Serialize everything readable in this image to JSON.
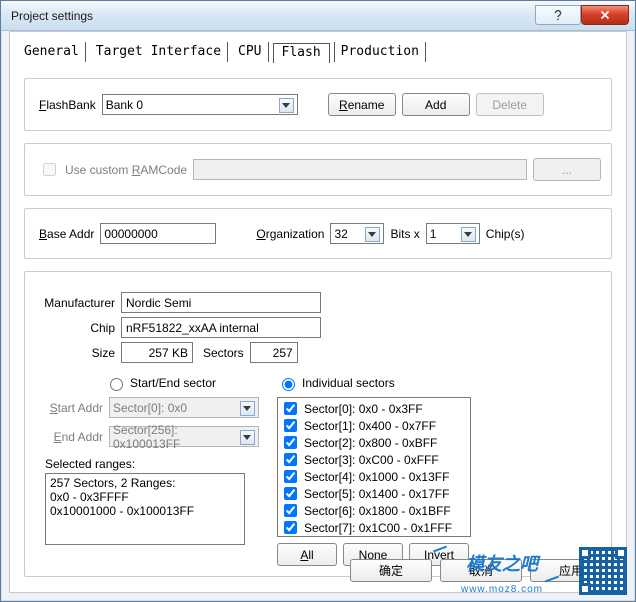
{
  "window": {
    "title": "Project settings"
  },
  "tabs": [
    {
      "label": "General"
    },
    {
      "label": "Target Interface"
    },
    {
      "label": "CPU"
    },
    {
      "label": "Flash"
    },
    {
      "label": "Production"
    }
  ],
  "bank": {
    "label_head": "F",
    "label_tail": "lashBank",
    "selected": "Bank 0",
    "rename_head": "R",
    "rename_tail": "ename",
    "add": "Add",
    "delete": "Delete"
  },
  "ramcode": {
    "label_pre": "Use custom ",
    "label_u": "R",
    "label_post": "AMCode",
    "value": ""
  },
  "addr": {
    "base_head": "B",
    "base_tail": "ase Addr",
    "base_value": "00000000",
    "org_head": "O",
    "org_tail": "rganization",
    "org_value": "32",
    "bits_label": "Bits x",
    "bits_value": "1",
    "chips_label": "Chip(s)"
  },
  "info": {
    "manu_label": "Manufacturer",
    "manu_value": "Nordic Semi",
    "chip_label": "Chip",
    "chip_value": "nRF51822_xxAA internal",
    "size_label": "Size",
    "size_value": "257 KB",
    "sectors_label": "Sectors",
    "sectors_value": "257"
  },
  "range": {
    "radio_startend": "Start/End sector",
    "radio_individual": "Individual sectors",
    "start_head": "S",
    "start_tail": "tart Addr",
    "start_value": "Sector[0]: 0x0",
    "end_head": "E",
    "end_tail": "nd Addr",
    "end_value": "Sector[256]: 0x100013FF",
    "selected_label": "Selected ranges:",
    "selected_lines": [
      "257 Sectors, 2 Ranges:",
      "0x0 - 0x3FFFF",
      "0x10001000 - 0x100013FF"
    ],
    "sectors": [
      "Sector[0]: 0x0 - 0x3FF",
      "Sector[1]: 0x400 - 0x7FF",
      "Sector[2]: 0x800 - 0xBFF",
      "Sector[3]: 0xC00 - 0xFFF",
      "Sector[4]: 0x1000 - 0x13FF",
      "Sector[5]: 0x1400 - 0x17FF",
      "Sector[6]: 0x1800 - 0x1BFF",
      "Sector[7]: 0x1C00 - 0x1FFF"
    ],
    "all_head": "A",
    "all_tail": "ll",
    "none_head": "N",
    "none_tail": "one",
    "invert_head": "I",
    "invert_tail": "nvert"
  },
  "footer": {
    "ok": "确定",
    "cancel": "取消",
    "apply": "应用"
  },
  "watermark": {
    "text": "模友之吧",
    "url": "www.moz8.com"
  }
}
